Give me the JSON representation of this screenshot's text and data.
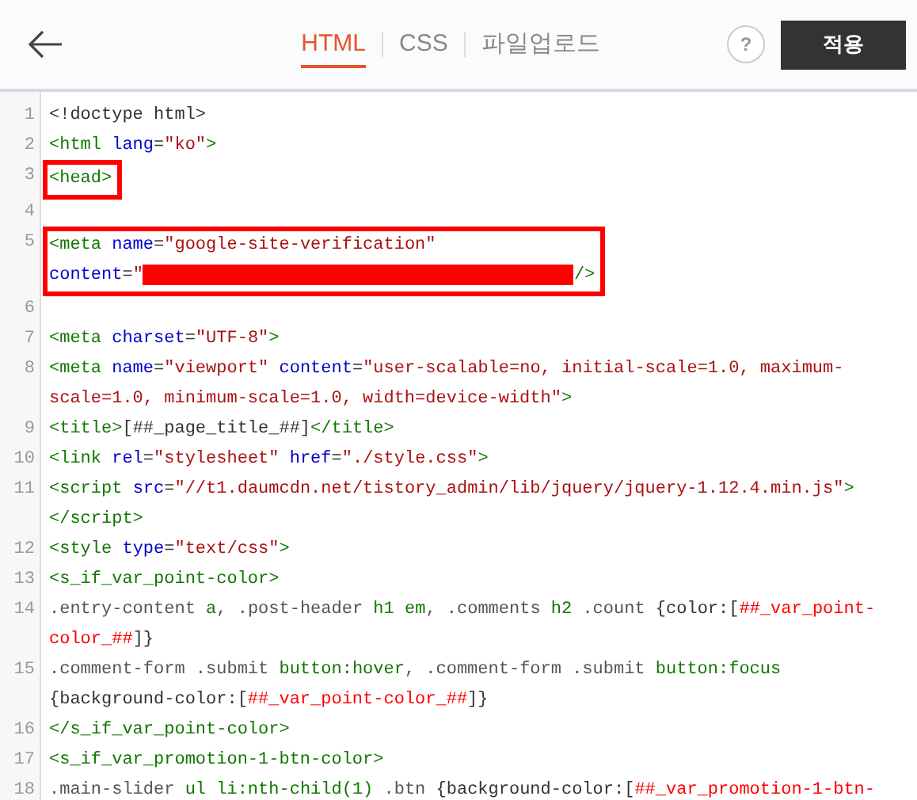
{
  "header": {
    "tabs": [
      {
        "label": "HTML",
        "selected": true
      },
      {
        "label": "CSS",
        "selected": false
      },
      {
        "label": "파일업로드",
        "selected": false
      }
    ],
    "help": "?",
    "apply_button": "적용"
  },
  "editor": {
    "lines": [
      {
        "number": "1",
        "highlighted": false,
        "rows": [
          {
            "tokens": [
              {
                "kind": "plain",
                "text": "<!doctype html>"
              }
            ]
          }
        ]
      },
      {
        "number": "2",
        "highlighted": false,
        "rows": [
          {
            "tokens": [
              {
                "kind": "tag",
                "text": "<html "
              },
              {
                "kind": "attr",
                "text": "lang"
              },
              {
                "kind": "plain",
                "text": "="
              },
              {
                "kind": "string",
                "text": "\"ko\""
              },
              {
                "kind": "tag",
                "text": ">"
              }
            ]
          }
        ]
      },
      {
        "number": "3",
        "highlighted": true,
        "rows": [
          {
            "tokens": [
              {
                "kind": "tag",
                "text": "<head>"
              }
            ]
          }
        ]
      },
      {
        "number": "4",
        "highlighted": false
      },
      {
        "number": "5",
        "highlighted": true,
        "rows": [
          {
            "tokens": [
              {
                "kind": "tag",
                "text": "<meta "
              },
              {
                "kind": "attr",
                "text": "name"
              },
              {
                "kind": "plain",
                "text": "="
              },
              {
                "kind": "string",
                "text": "\"google-site-verification\""
              }
            ]
          },
          {
            "tokens": [
              {
                "kind": "attr",
                "text": "content"
              },
              {
                "kind": "plain",
                "text": "="
              },
              {
                "kind": "string",
                "text": "\""
              },
              {
                "kind": "redacted"
              },
              {
                "kind": "tag",
                "text": "/>"
              }
            ]
          }
        ]
      },
      {
        "number": "6",
        "highlighted": false
      },
      {
        "number": "7",
        "highlighted": false,
        "rows": [
          {
            "tokens": [
              {
                "kind": "tag",
                "text": "<meta "
              },
              {
                "kind": "attr",
                "text": "charset"
              },
              {
                "kind": "plain",
                "text": "="
              },
              {
                "kind": "string",
                "text": "\"UTF-8\""
              },
              {
                "kind": "tag",
                "text": ">"
              }
            ]
          }
        ]
      },
      {
        "number": "8",
        "highlighted": false,
        "rows": [
          {
            "tokens": [
              {
                "kind": "tag",
                "text": "<meta "
              },
              {
                "kind": "attr",
                "text": "name"
              },
              {
                "kind": "plain",
                "text": "="
              },
              {
                "kind": "string",
                "text": "\"viewport\" "
              },
              {
                "kind": "attr",
                "text": "content"
              },
              {
                "kind": "plain",
                "text": "="
              },
              {
                "kind": "string",
                "text": "\"user-scalable=no, initial-scale=1.0, maximum-"
              }
            ]
          },
          {
            "tokens": [
              {
                "kind": "string",
                "text": "scale=1.0, minimum-scale=1.0, width=device-width\""
              },
              {
                "kind": "tag",
                "text": ">"
              }
            ]
          }
        ]
      },
      {
        "number": "9",
        "highlighted": false,
        "rows": [
          {
            "tokens": [
              {
                "kind": "tag",
                "text": "<title>"
              },
              {
                "kind": "plain",
                "text": "[##_page_title_##]"
              },
              {
                "kind": "tag",
                "text": "</title>"
              }
            ]
          }
        ]
      },
      {
        "number": "10",
        "highlighted": false,
        "rows": [
          {
            "tokens": [
              {
                "kind": "tag",
                "text": "<link "
              },
              {
                "kind": "attr",
                "text": "rel"
              },
              {
                "kind": "plain",
                "text": "="
              },
              {
                "kind": "string",
                "text": "\"stylesheet\" "
              },
              {
                "kind": "attr",
                "text": "href"
              },
              {
                "kind": "plain",
                "text": "="
              },
              {
                "kind": "string",
                "text": "\"./style.css\""
              },
              {
                "kind": "tag",
                "text": ">"
              }
            ]
          }
        ]
      },
      {
        "number": "11",
        "highlighted": false,
        "rows": [
          {
            "tokens": [
              {
                "kind": "tag",
                "text": "<script "
              },
              {
                "kind": "attr",
                "text": "src"
              },
              {
                "kind": "plain",
                "text": "="
              },
              {
                "kind": "string",
                "text": "\"//t1.daumcdn.net/tistory_admin/lib/jquery/jquery-1.12.4.min.js\""
              },
              {
                "kind": "tag",
                "text": ">"
              }
            ]
          },
          {
            "tokens": [
              {
                "kind": "tag",
                "text": "</script>"
              }
            ]
          }
        ]
      },
      {
        "number": "12",
        "highlighted": false,
        "rows": [
          {
            "tokens": [
              {
                "kind": "tag",
                "text": "<style "
              },
              {
                "kind": "attr",
                "text": "type"
              },
              {
                "kind": "plain",
                "text": "="
              },
              {
                "kind": "string",
                "text": "\"text/css\""
              },
              {
                "kind": "tag",
                "text": ">"
              }
            ]
          }
        ]
      },
      {
        "number": "13",
        "highlighted": false,
        "rows": [
          {
            "tokens": [
              {
                "kind": "tag",
                "text": "<s_if_var_point-color>"
              }
            ]
          }
        ]
      },
      {
        "number": "14",
        "highlighted": false,
        "rows": [
          {
            "tokens": [
              {
                "kind": "qualifier",
                "text": ".entry-content "
              },
              {
                "kind": "tag",
                "text": "a"
              },
              {
                "kind": "qualifier",
                "text": ", .post-header "
              },
              {
                "kind": "tag",
                "text": "h1 em"
              },
              {
                "kind": "qualifier",
                "text": ", .comments "
              },
              {
                "kind": "tag",
                "text": "h2"
              },
              {
                "kind": "qualifier",
                "text": " .count "
              },
              {
                "kind": "plain",
                "text": "{color:["
              },
              {
                "kind": "var",
                "text": "##_var_point-"
              }
            ]
          },
          {
            "tokens": [
              {
                "kind": "var",
                "text": "color_##"
              },
              {
                "kind": "plain",
                "text": "]}"
              }
            ]
          }
        ]
      },
      {
        "number": "15",
        "highlighted": false,
        "rows": [
          {
            "tokens": [
              {
                "kind": "qualifier",
                "text": ".comment-form .submit "
              },
              {
                "kind": "tag",
                "text": "button:hover"
              },
              {
                "kind": "qualifier",
                "text": ", .comment-form .submit "
              },
              {
                "kind": "tag",
                "text": "button:focus"
              }
            ]
          },
          {
            "tokens": [
              {
                "kind": "plain",
                "text": "{background-color:["
              },
              {
                "kind": "var",
                "text": "##_var_point-color_##"
              },
              {
                "kind": "plain",
                "text": "]}"
              }
            ]
          }
        ]
      },
      {
        "number": "16",
        "highlighted": false,
        "rows": [
          {
            "tokens": [
              {
                "kind": "tag",
                "text": "</s_if_var_point-color>"
              }
            ]
          }
        ]
      },
      {
        "number": "17",
        "highlighted": false,
        "rows": [
          {
            "tokens": [
              {
                "kind": "tag",
                "text": "<s_if_var_promotion-1-btn-color>"
              }
            ]
          }
        ]
      },
      {
        "number": "18",
        "highlighted": false,
        "rows": [
          {
            "tokens": [
              {
                "kind": "qualifier",
                "text": ".main-slider "
              },
              {
                "kind": "tag",
                "text": "ul li:nth-child(1)"
              },
              {
                "kind": "qualifier",
                "text": " .btn "
              },
              {
                "kind": "plain",
                "text": "{background-color:["
              },
              {
                "kind": "var",
                "text": "##_var_promotion-1-btn-"
              }
            ]
          }
        ]
      }
    ]
  }
}
